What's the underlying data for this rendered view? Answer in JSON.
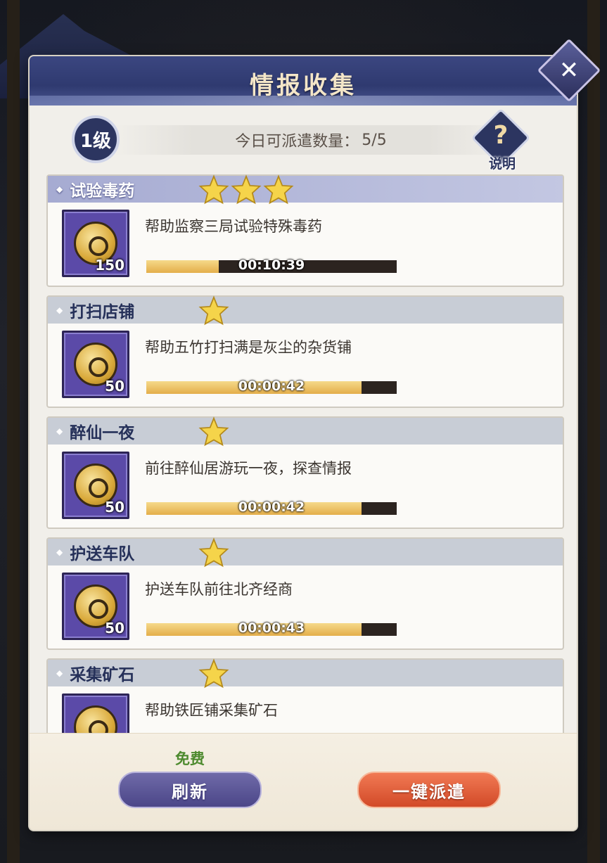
{
  "dialog": {
    "title": "情报收集",
    "close_icon": "close-icon"
  },
  "info": {
    "level": "1级",
    "dispatch_label": "今日可派遣数量：",
    "dispatch_value": "5/5",
    "help_symbol": "?",
    "help_label": "说明"
  },
  "tasks": [
    {
      "name": "试验毒药",
      "stars": 3,
      "desc": "帮助监察三局试验特殊毒药",
      "reward": "150",
      "time": "00:10:39",
      "progress": 0.29,
      "highlight": true
    },
    {
      "name": "打扫店铺",
      "stars": 1,
      "desc": "帮助五竹打扫满是灰尘的杂货铺",
      "reward": "50",
      "time": "00:00:42",
      "progress": 0.86,
      "highlight": false
    },
    {
      "name": "醉仙一夜",
      "stars": 1,
      "desc": "前往醉仙居游玩一夜，探查情报",
      "reward": "50",
      "time": "00:00:42",
      "progress": 0.86,
      "highlight": false
    },
    {
      "name": "护送车队",
      "stars": 1,
      "desc": "护送车队前往北齐经商",
      "reward": "50",
      "time": "00:00:43",
      "progress": 0.86,
      "highlight": false
    },
    {
      "name": "采集矿石",
      "stars": 1,
      "desc": "帮助铁匠铺采集矿石",
      "reward": "",
      "time": "",
      "progress": 0,
      "highlight": false
    }
  ],
  "footer": {
    "free_label": "免费",
    "refresh_label": "刷新",
    "dispatch_all_label": "一键派遣"
  },
  "colors": {
    "accent": "#2f3a70",
    "star": "#f5d44a",
    "progress_fill": "#e4ae4a",
    "dispatch_button": "#d24a28",
    "refresh_button": "#4b4688"
  }
}
